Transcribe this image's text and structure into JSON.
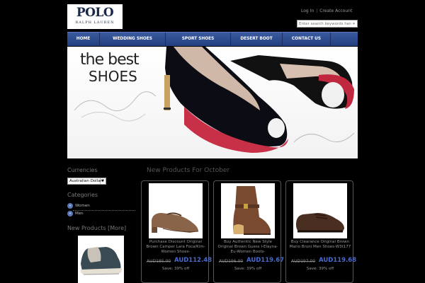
{
  "logo": {
    "line1": "POLO",
    "line2": "RALPH LAUREN"
  },
  "top_links": {
    "login": "Log In",
    "create": "Create Account"
  },
  "search": {
    "placeholder": "Enter search keywords here"
  },
  "nav": {
    "items": [
      {
        "label": "HOME"
      },
      {
        "label": "WEDDING SHOES"
      },
      {
        "label": "SPORT SHOES"
      },
      {
        "label": "DESERT BOOT"
      },
      {
        "label": "CONTACT US"
      }
    ]
  },
  "banner": {
    "line1": "the best",
    "line2": "SHOES"
  },
  "sidebar": {
    "currencies_title": "Currencies",
    "currency_selected": "Australian Dollar",
    "categories_title": "Categories",
    "categories": [
      {
        "label": "Women"
      },
      {
        "label": "Men"
      }
    ],
    "new_products_title": "New Products  [More]"
  },
  "main": {
    "new_products_title": "New Products For October",
    "products": [
      {
        "name": "Purchase Discount Original Brown Camper Lara Foca/Kim-Women Shoes-",
        "old_price": "AUD185.00",
        "new_price": "AUD112.48",
        "save": "Save: 39% off"
      },
      {
        "name": "Buy Authentic New Style Original Brown Guess I-Elayna-Eu-Women Boots-",
        "old_price": "AUD196.00",
        "new_price": "AUD119.67",
        "save": "Save: 39% off"
      },
      {
        "name": "Buy Clearance Original Brown Mario Bruni Men Shoes-W3t177",
        "old_price": "AUD197.00",
        "new_price": "AUD119.68",
        "save": "Save: 39% off"
      }
    ]
  },
  "colors": {
    "nav": "#2a4a8e",
    "price": "#4a6ad0",
    "background": "#000000",
    "banner_accent": "#d0304a"
  }
}
